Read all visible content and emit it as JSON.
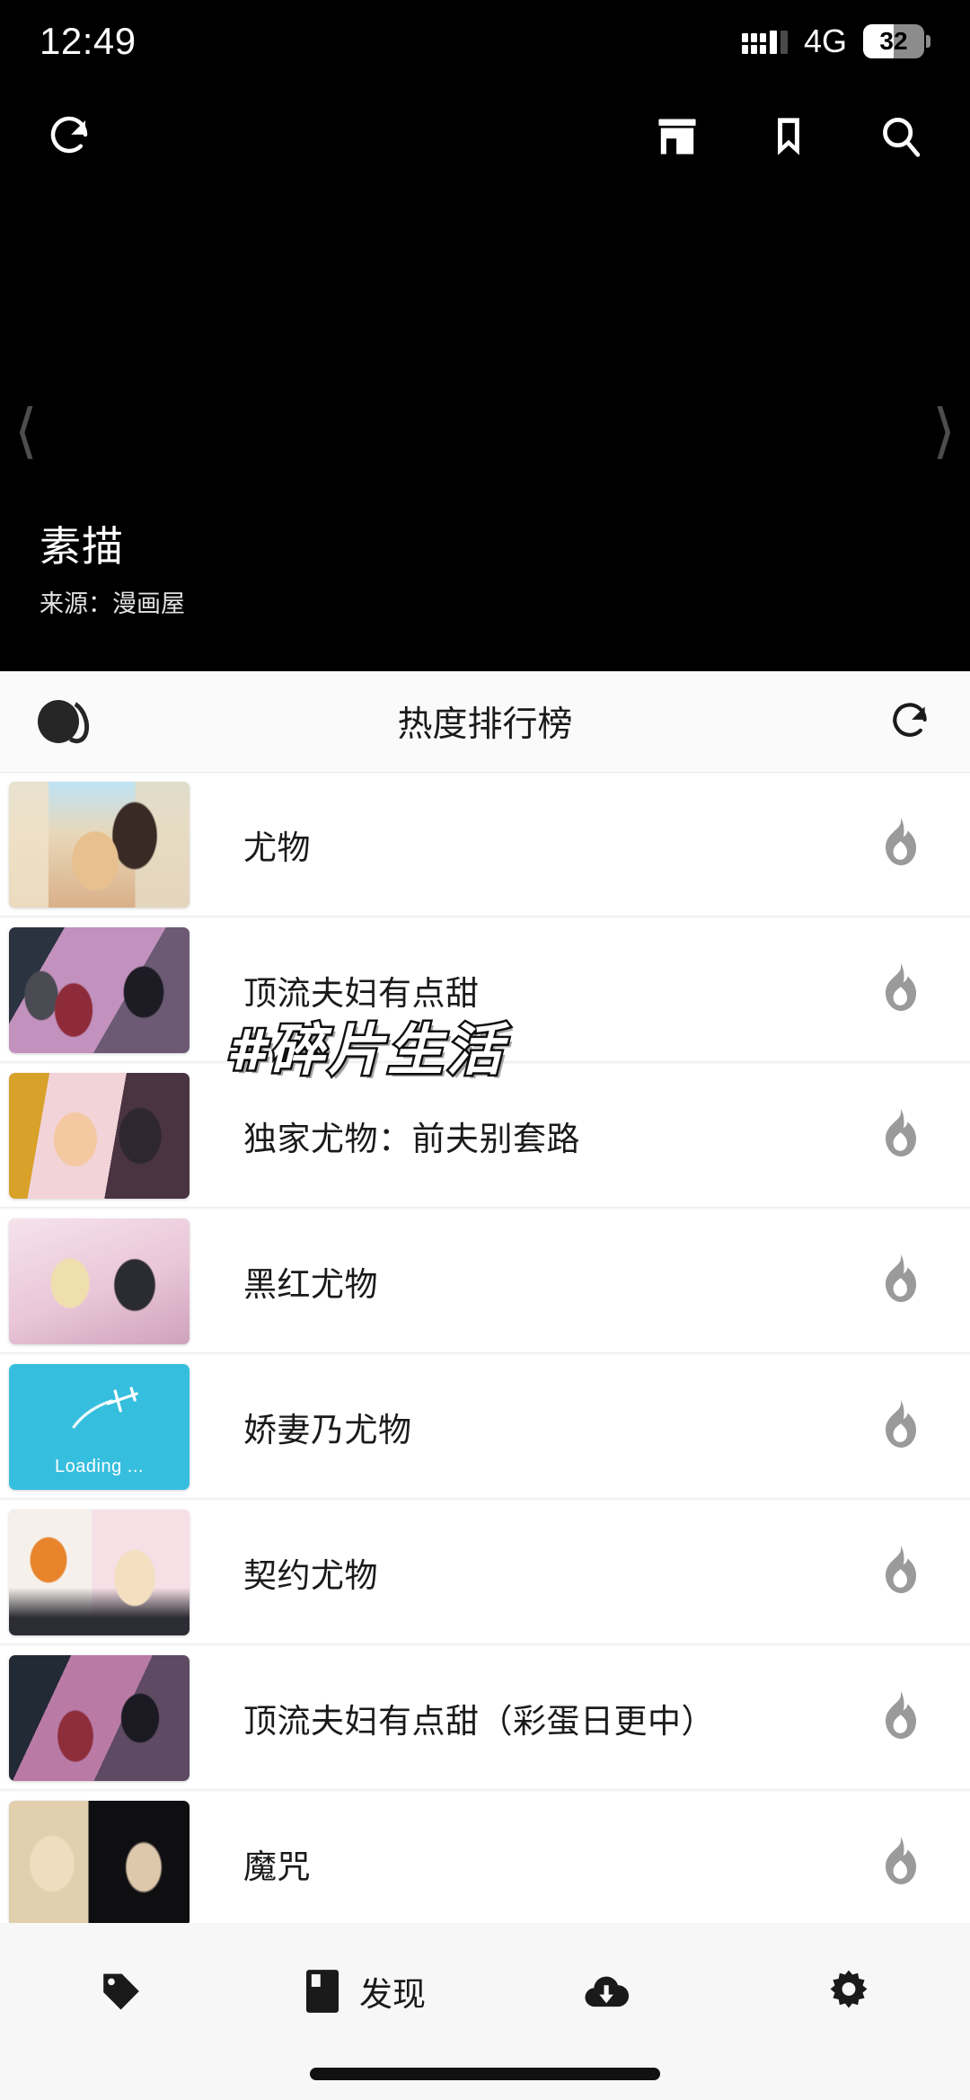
{
  "status_bar": {
    "time": "12:49",
    "network": "4G",
    "battery_percent": "32",
    "signal_icon": "dual-sim-signal-icon",
    "battery_icon": "battery-icon"
  },
  "toolbar": {
    "refresh_icon": "refresh-icon",
    "store_icon": "store-icon",
    "bookmark_icon": "bookmark-icon",
    "search_icon": "search-icon"
  },
  "hero": {
    "title": "素描",
    "source": "来源：漫画屋",
    "prev_icon": "chevron-left-icon",
    "next_icon": "chevron-right-icon"
  },
  "list_header": {
    "title": "热度排行榜",
    "theme_toggle_icon": "dark-mode-toggle-icon",
    "refresh_icon": "refresh-icon"
  },
  "list": {
    "items": [
      {
        "title": "尤物",
        "trend_icon": "flame-icon",
        "thumb": "couple-window-sunset",
        "loading": false
      },
      {
        "title": "顶流夫妇有点甜",
        "trend_icon": "flame-icon",
        "thumb": "group-purple-scene",
        "loading": false
      },
      {
        "title": "独家尤物：前夫别套路",
        "trend_icon": "flame-icon",
        "thumb": "kiss-gold-lights",
        "loading": false
      },
      {
        "title": "黑红尤物",
        "trend_icon": "flame-icon",
        "thumb": "pink-pair-suit",
        "loading": false
      },
      {
        "title": "娇妻乃尤物",
        "trend_icon": "flame-icon",
        "thumb": "loading-placeholder",
        "loading": true,
        "loading_text": "Loading ..."
      },
      {
        "title": "契约尤物",
        "trend_icon": "flame-icon",
        "thumb": "orange-hair-pair",
        "loading": false
      },
      {
        "title": "顶流夫妇有点甜（彩蛋日更中）",
        "trend_icon": "flame-icon",
        "thumb": "dark-red-scene",
        "loading": false
      },
      {
        "title": "魔咒",
        "trend_icon": "flame-icon",
        "thumb": "manga-two-faces",
        "loading": false
      }
    ]
  },
  "watermark": {
    "text": "#碎片生活"
  },
  "bottom_nav": {
    "items": [
      {
        "icon": "tag-icon",
        "label": ""
      },
      {
        "icon": "book-icon",
        "label": "发现"
      },
      {
        "icon": "download-icon",
        "label": ""
      },
      {
        "icon": "gear-icon",
        "label": ""
      }
    ]
  },
  "colors": {
    "banner_bg": "#000000",
    "page_bg": "#f7f7f7",
    "row_bg": "#ffffff",
    "flame": "#9a9a9a",
    "loading_bg": "#36bede"
  }
}
